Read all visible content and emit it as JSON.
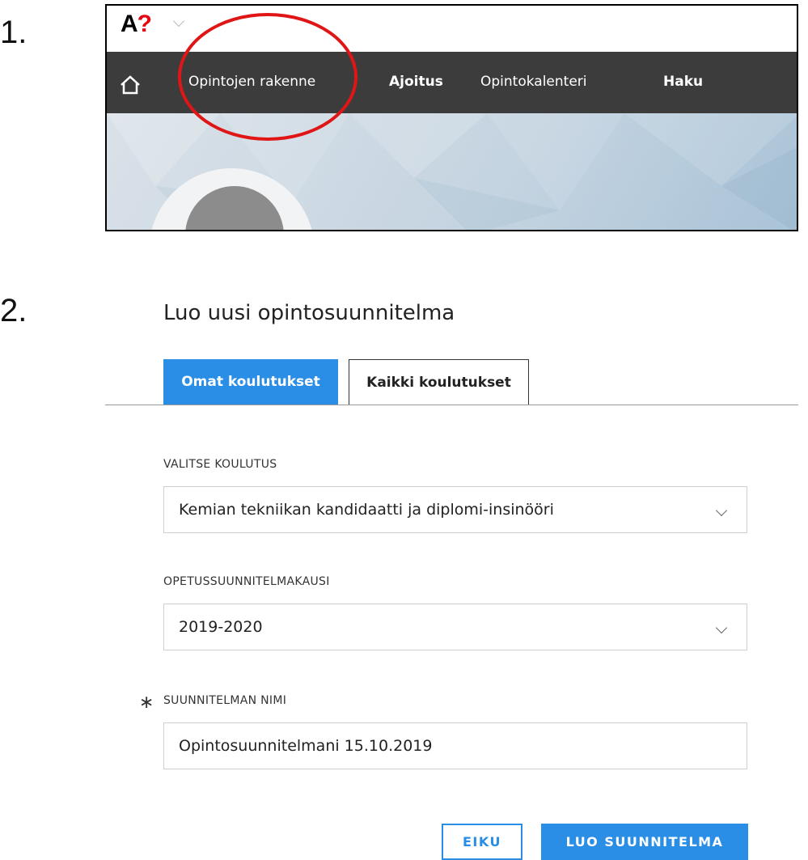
{
  "steps": {
    "one": "1.",
    "two": "2."
  },
  "screenshot": {
    "logo": {
      "letter": "A",
      "mark": "?"
    },
    "icons": {
      "home": "home-icon",
      "logo_menu": "chevron-down-icon"
    },
    "nav": {
      "items": [
        {
          "label": "Opintojen rakenne"
        },
        {
          "label": "Ajoitus"
        },
        {
          "label": "Opintokalenteri"
        },
        {
          "label": "Haku"
        }
      ]
    },
    "highlight_color": "#e01616"
  },
  "form": {
    "title": "Luo uusi opintosuunnitelma",
    "tabs": [
      {
        "label": "Omat koulutukset",
        "active": true
      },
      {
        "label": "Kaikki koulutukset",
        "active": false
      }
    ],
    "fields": {
      "program": {
        "label": "VALITSE KOULUTUS",
        "value": "Kemian tekniikan kandidaatti ja diplomi-insinööri"
      },
      "curriculum": {
        "label": "OPETUSSUUNNITELMAKAUSI",
        "value": "2019-2020"
      },
      "plan_name": {
        "required_mark": "∗",
        "label": "SUUNNITELMAN NIMI",
        "value": "Opintosuunnitelmani 15.10.2019"
      }
    },
    "buttons": {
      "cancel": "EIKU",
      "create": "LUO SUUNNITELMA"
    },
    "accent_color": "#2b8ee6"
  }
}
